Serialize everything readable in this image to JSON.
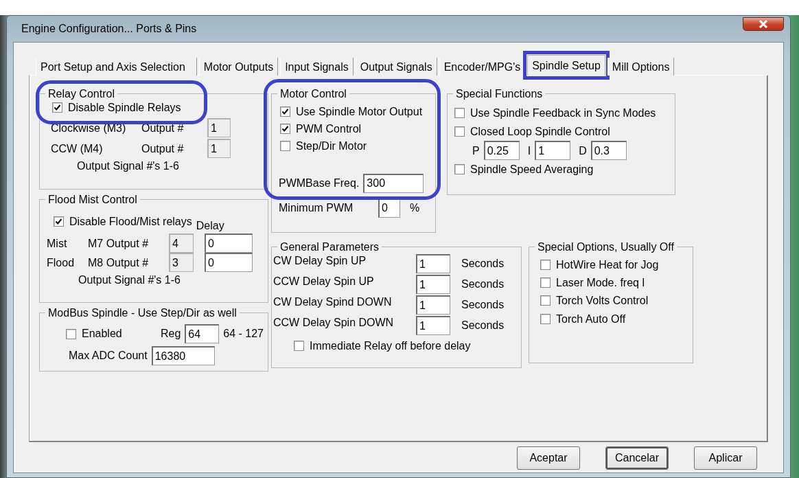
{
  "window": {
    "title": "Engine Configuration... Ports & Pins"
  },
  "tabs": [
    {
      "label": "Port Setup and Axis Selection",
      "selected": false,
      "highlighted": false
    },
    {
      "label": "Motor Outputs",
      "selected": false,
      "highlighted": false
    },
    {
      "label": "Input Signals",
      "selected": false,
      "highlighted": false
    },
    {
      "label": "Output Signals",
      "selected": false,
      "highlighted": false
    },
    {
      "label": "Encoder/MPG's",
      "selected": false,
      "highlighted": false
    },
    {
      "label": "Spindle Setup",
      "selected": true,
      "highlighted": true
    },
    {
      "label": "Mill Options",
      "selected": false,
      "highlighted": false
    }
  ],
  "relay_control": {
    "title": "Relay Control",
    "highlighted": true,
    "disable": {
      "label": "Disable Spindle Relays",
      "checked": true
    },
    "rows": [
      {
        "label": "Clockwise (M3)",
        "field_label": "Output #",
        "output": {
          "value": "1",
          "disabled": true
        }
      },
      {
        "label": "CCW (M4)",
        "field_label": "Output #",
        "output": {
          "value": "1",
          "disabled": true
        }
      }
    ],
    "note": "Output Signal #'s 1-6"
  },
  "flood_mist": {
    "title": "Flood Mist Control",
    "disable": {
      "label": "Disable Flood/Mist relays",
      "checked": true
    },
    "delay_heading": "Delay",
    "rows": [
      {
        "label": "Mist",
        "field_label": "M7 Output #",
        "output": {
          "value": "4",
          "disabled": true
        },
        "delay": {
          "value": "0",
          "disabled": false
        }
      },
      {
        "label": "Flood",
        "field_label": "M8 Output #",
        "output": {
          "value": "3",
          "disabled": true
        },
        "delay": {
          "value": "0",
          "disabled": false
        }
      }
    ],
    "note": "Output Signal #'s 1-6"
  },
  "modbus": {
    "title": "ModBus Spindle - Use Step/Dir as well",
    "enabled": {
      "label": "Enabled",
      "checked": false
    },
    "reg_label": "Reg",
    "reg": {
      "value": "64",
      "disabled": false
    },
    "range": "64 - 127",
    "max_label": "Max ADC Count",
    "max": {
      "value": "16380",
      "disabled": false
    }
  },
  "motor_control": {
    "title": "Motor Control",
    "highlighted": true,
    "options": [
      {
        "label": "Use Spindle Motor Output",
        "checked": true
      },
      {
        "label": "PWM Control",
        "checked": true
      },
      {
        "label": "Step/Dir Motor",
        "checked": false
      }
    ],
    "freq_label": "PWMBase Freq.",
    "freq": {
      "value": "300",
      "disabled": false
    },
    "min_label": "Minimum PWM",
    "min": {
      "value": "0",
      "disabled": false
    },
    "min_unit": "%"
  },
  "special_functions": {
    "title": "Special Functions",
    "options": [
      {
        "label": "Use Spindle Feedback in Sync Modes",
        "checked": false
      },
      {
        "label": "Closed Loop Spindle Control",
        "checked": false
      }
    ],
    "pid": [
      {
        "label": "P",
        "field": {
          "value": "0.25",
          "disabled": false
        }
      },
      {
        "label": "I",
        "field": {
          "value": "1",
          "disabled": false
        }
      },
      {
        "label": "D",
        "field": {
          "value": "0.3",
          "disabled": false
        }
      }
    ],
    "averaging": {
      "label": "Spindle Speed Averaging",
      "checked": false
    }
  },
  "general_parameters": {
    "title": "General Parameters",
    "rows": [
      {
        "label": "CW Delay Spin UP",
        "field": {
          "value": "1",
          "disabled": false
        },
        "unit": "Seconds"
      },
      {
        "label": "CCW Delay Spin UP",
        "field": {
          "value": "1",
          "disabled": false
        },
        "unit": "Seconds"
      },
      {
        "label": "CW Delay Spind DOWN",
        "field": {
          "value": "1",
          "disabled": false
        },
        "unit": "Seconds"
      },
      {
        "label": "CCW Delay Spin DOWN",
        "field": {
          "value": "1",
          "disabled": false
        },
        "unit": "Seconds"
      }
    ],
    "immediate": {
      "label": "Immediate Relay off before delay",
      "checked": false
    }
  },
  "special_options": {
    "title": "Special Options, Usually Off",
    "options": [
      {
        "label": "HotWire Heat for Jog",
        "checked": false
      },
      {
        "label": "Laser Mode. freq l",
        "checked": false
      },
      {
        "label": "Torch Volts Control",
        "checked": false
      },
      {
        "label": "Torch Auto Off",
        "checked": false
      }
    ]
  },
  "buttons": [
    {
      "label": "Aceptar",
      "focused": false
    },
    {
      "label": "Cancelar",
      "focused": true
    },
    {
      "label": "Aplicar",
      "focused": false
    }
  ]
}
